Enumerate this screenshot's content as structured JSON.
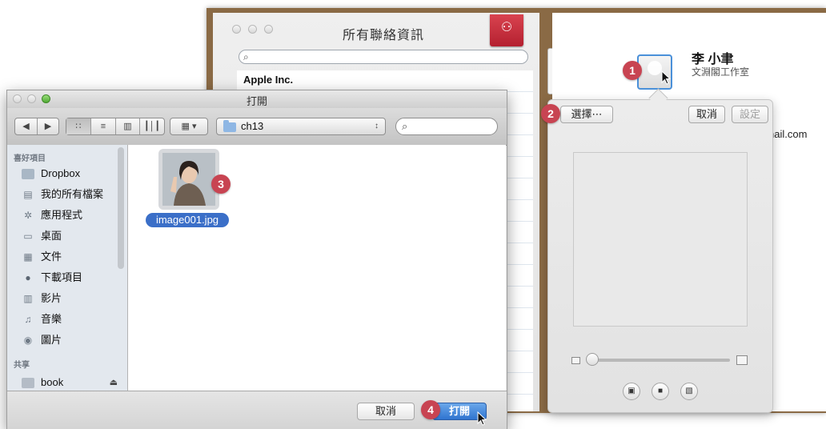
{
  "contacts_window": {
    "title": "所有聯絡資訊",
    "search_placeholder": "",
    "group_row": "Apple Inc.",
    "contact": {
      "name": "李 小聿",
      "company": "文淵閣工作室",
      "email_fragment": "nail.com"
    },
    "photo_popover": {
      "choose_button": "選擇⋯",
      "cancel_button": "取消",
      "set_button": "設定"
    }
  },
  "open_dialog": {
    "title": "打開",
    "path_popup": "ch13",
    "search_placeholder": "",
    "sidebar": {
      "favorites_header": "喜好項目",
      "favorites": [
        {
          "label": "Dropbox",
          "icon": "folder-icon"
        },
        {
          "label": "我的所有檔案",
          "icon": "all-files-icon"
        },
        {
          "label": "應用程式",
          "icon": "applications-icon"
        },
        {
          "label": "桌面",
          "icon": "desktop-icon"
        },
        {
          "label": "文件",
          "icon": "documents-icon"
        },
        {
          "label": "下載項目",
          "icon": "downloads-icon"
        },
        {
          "label": "影片",
          "icon": "movies-icon"
        },
        {
          "label": "音樂",
          "icon": "music-icon"
        },
        {
          "label": "圖片",
          "icon": "pictures-icon"
        }
      ],
      "shared_header": "共享",
      "shared": [
        {
          "label": "book",
          "icon": "computer-icon"
        }
      ]
    },
    "file": {
      "name": "image001.jpg"
    },
    "cancel_button": "取消",
    "open_button": "打開"
  },
  "steps": [
    "1",
    "2",
    "3",
    "4"
  ],
  "colors": {
    "badge": "#c84452",
    "selection": "#3b6fc8",
    "wood": "#8a6a45"
  }
}
